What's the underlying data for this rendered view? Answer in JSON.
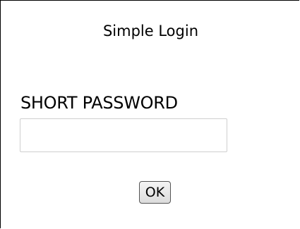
{
  "login": {
    "title": "Simple Login",
    "field_label": "SHORT PASSWORD",
    "password_value": "",
    "password_placeholder": "",
    "ok_label": "OK"
  }
}
